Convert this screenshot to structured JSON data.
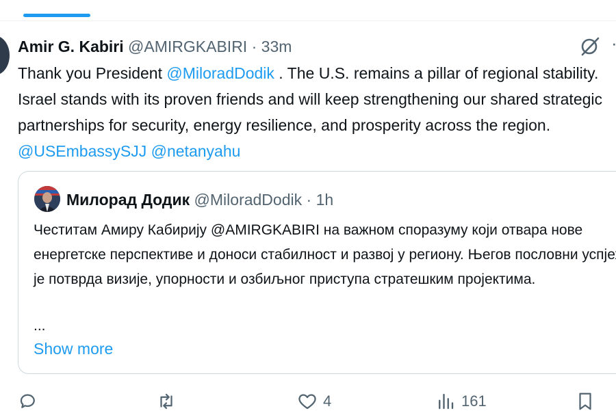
{
  "tweet": {
    "author_name": "Amir G. Kabiri",
    "author_handle": "@AMIRGKABIRI",
    "separator": "·",
    "time": "33m",
    "text": {
      "part1": "Thank you President ",
      "mention1": "@MiloradDodik",
      "part2": " . The U.S. remains a pillar of regional stability. Israel stands with its proven friends and will keep strengthening our shared strategic partnerships for security, energy resilience, and prosperity across the region. ",
      "mention2": "@USEmbassySJJ",
      "space": " ",
      "mention3": "@netanyahu"
    }
  },
  "quote": {
    "author_name": "Милорад Додик",
    "author_handle": "@MiloradDodik",
    "separator": "·",
    "time": "1h",
    "text": "Честитам Амиру Кабирију @AMIRGKABIRI на важном споразуму који отвара нове енергетске перспективе и доноси стабилност и развој у региону. Његов пословни успјех је потврда визије, упорности и озбиљног приступа стратешким пројектима.",
    "ellipsis": "...",
    "show_more": "Show more"
  },
  "actions": {
    "reply_count": "",
    "retweet_count": "",
    "like_count": "4",
    "views_count": "161"
  },
  "icons": {
    "grok": "grok-icon",
    "more": "more-icon",
    "reply": "reply-icon",
    "retweet": "retweet-icon",
    "like": "heart-icon",
    "views": "views-icon",
    "bookmark": "bookmark-icon"
  },
  "colors": {
    "accent": "#1d9bf0",
    "text": "#0f1419",
    "muted": "#536471",
    "border": "#cfd9de"
  }
}
